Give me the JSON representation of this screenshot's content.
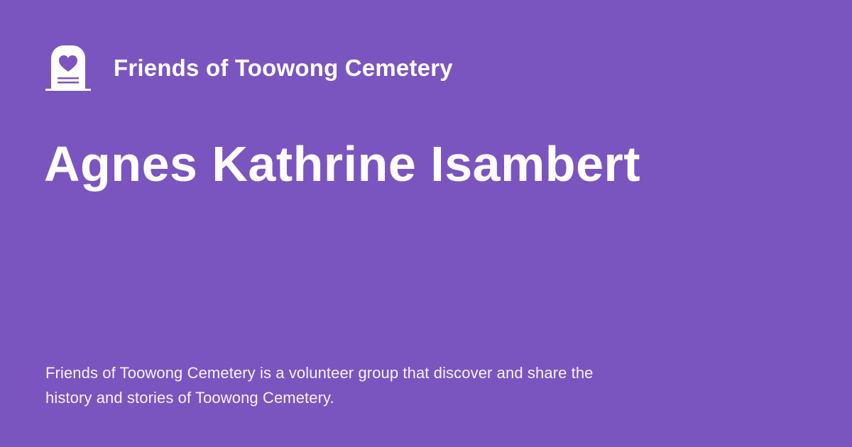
{
  "theme": {
    "background_color": "#7b55bf",
    "text_color": "#ffffff"
  },
  "brand": {
    "logo_icon": "headstone-heart-icon",
    "name": "Friends of Toowong Cemetery"
  },
  "page": {
    "title": "Agnes Kathrine Isambert",
    "description": "Friends of Toowong Cemetery is a volunteer group that discover and share the history and stories of Toowong Cemetery."
  }
}
